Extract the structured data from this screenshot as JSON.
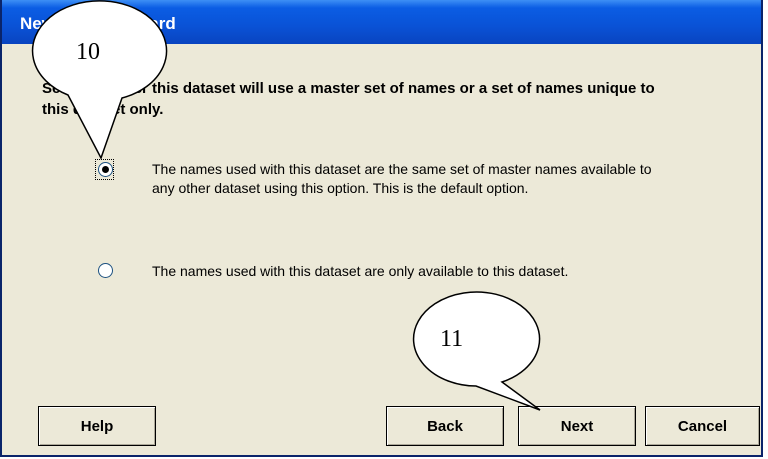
{
  "window": {
    "title": "New Names Wizard"
  },
  "instruction": "Select whether this dataset will use a master set of names or a set of names unique to this dataset only.",
  "options": [
    {
      "label": "The names used with this dataset are the same set of master names available to any other dataset using this option.  This is the default option.",
      "checked": true
    },
    {
      "label": "The names used with this dataset are only available to this dataset.",
      "checked": false
    }
  ],
  "buttons": {
    "help": "Help",
    "back": "Back",
    "next": "Next",
    "cancel": "Cancel"
  },
  "callouts": [
    {
      "number": "10"
    },
    {
      "number": "11"
    }
  ]
}
